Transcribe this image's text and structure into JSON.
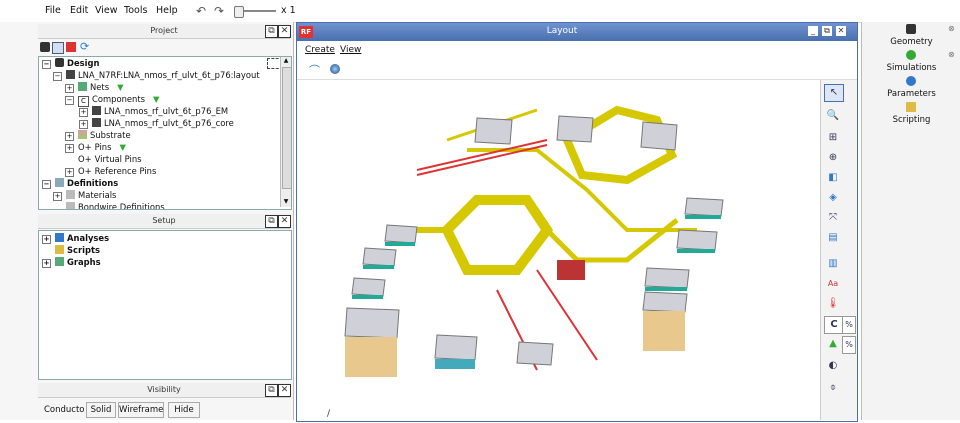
{
  "menu": {
    "file": "File",
    "edit": "Edit",
    "view": "View",
    "tools": "Tools",
    "help": "Help",
    "zoom_label": "x 1"
  },
  "project": {
    "title": "Project",
    "tree": {
      "design": "Design",
      "layout_path": "LNA_N7RF:LNA_nmos_rf_ulvt_6t_p76:layout",
      "nets": "Nets",
      "components": "Components",
      "comp1": "LNA_nmos_rf_ulvt_6t_p76_EM",
      "comp2": "LNA_nmos_rf_ulvt_6t_p76_core",
      "substrate": "Substrate",
      "pins": "Pins",
      "virtual_pins": "Virtual Pins",
      "reference_pins": "Reference Pins",
      "definitions": "Definitions",
      "materials": "Materials",
      "bondwire": "Bondwire Definitions"
    }
  },
  "setup": {
    "title": "Setup",
    "analyses": "Analyses",
    "scripts": "Scripts",
    "graphs": "Graphs"
  },
  "visibility": {
    "title": "Visibility",
    "conductors": "Conducto",
    "solid": "Solid",
    "wireframe": "Wireframe",
    "hide": "Hide"
  },
  "layout": {
    "title": "Layout",
    "rf_badge": "RF",
    "menu_create": "Create",
    "menu_view": "View"
  },
  "right_tabs": {
    "geometry": "Geometry",
    "simulations": "Simulations",
    "parameters": "Parameters",
    "scripting": "Scripting"
  },
  "tools": {
    "percent": "%",
    "aa": "Aa",
    "c": "C"
  },
  "colors": {
    "accent": "#4a6fae",
    "title_gradient_top": "#6f92d0",
    "trace_yellow": "#d6c800",
    "pad_grey": "#cfd0d8"
  }
}
